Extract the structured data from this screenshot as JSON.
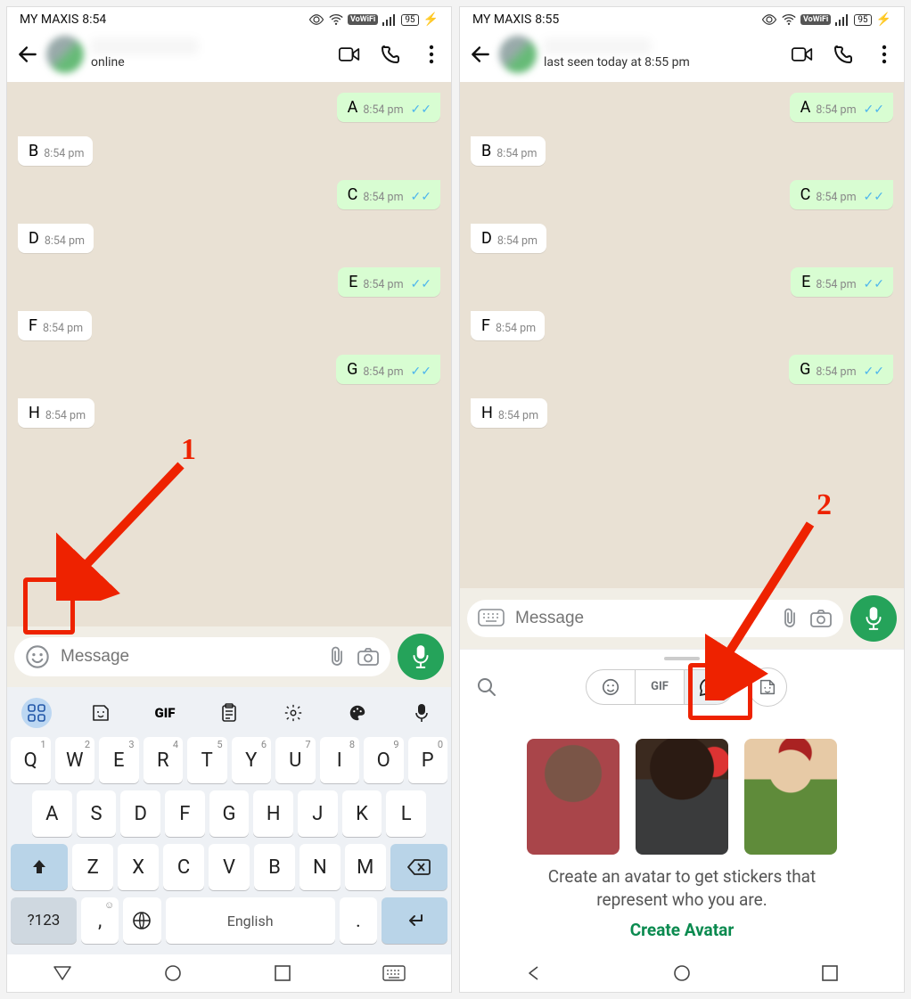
{
  "annotations": {
    "one": "1",
    "two": "2"
  },
  "left": {
    "status": {
      "carrier": "MY MAXIS",
      "time": "8:54",
      "battery": "95"
    },
    "header": {
      "sub": "online"
    },
    "messages": [
      {
        "dir": "out",
        "txt": "A",
        "time": "8:54 pm"
      },
      {
        "dir": "in",
        "txt": "B",
        "time": "8:54 pm"
      },
      {
        "dir": "out",
        "txt": "C",
        "time": "8:54 pm"
      },
      {
        "dir": "in",
        "txt": "D",
        "time": "8:54 pm"
      },
      {
        "dir": "out",
        "txt": "E",
        "time": "8:54 pm"
      },
      {
        "dir": "in",
        "txt": "F",
        "time": "8:54 pm"
      },
      {
        "dir": "out",
        "txt": "G",
        "time": "8:54 pm"
      },
      {
        "dir": "in",
        "txt": "H",
        "time": "8:54 pm"
      }
    ],
    "input": {
      "placeholder": "Message"
    },
    "kb": {
      "tool": [
        "apps",
        "sticker",
        "gif",
        "clipboard",
        "settings",
        "palette",
        "mic"
      ],
      "gif": "GIF",
      "r1": [
        "Q",
        "W",
        "E",
        "R",
        "T",
        "Y",
        "U",
        "I",
        "O",
        "P"
      ],
      "r1s": [
        "1",
        "2",
        "3",
        "4",
        "5",
        "6",
        "7",
        "8",
        "9",
        "0"
      ],
      "r2": [
        "A",
        "S",
        "D",
        "F",
        "G",
        "H",
        "J",
        "K",
        "L"
      ],
      "r3": [
        "Z",
        "X",
        "C",
        "V",
        "B",
        "N",
        "M"
      ],
      "sym": "?123",
      "lang": "English",
      "comma": ",",
      "dot": "."
    }
  },
  "right": {
    "status": {
      "carrier": "MY MAXIS",
      "time": "8:55",
      "battery": "95"
    },
    "header": {
      "sub": "last seen today at 8:55 pm"
    },
    "messages": [
      {
        "dir": "out",
        "txt": "A",
        "time": "8:54 pm"
      },
      {
        "dir": "in",
        "txt": "B",
        "time": "8:54 pm"
      },
      {
        "dir": "out",
        "txt": "C",
        "time": "8:54 pm"
      },
      {
        "dir": "in",
        "txt": "D",
        "time": "8:54 pm"
      },
      {
        "dir": "out",
        "txt": "E",
        "time": "8:54 pm"
      },
      {
        "dir": "in",
        "txt": "F",
        "time": "8:54 pm"
      },
      {
        "dir": "out",
        "txt": "G",
        "time": "8:54 pm"
      },
      {
        "dir": "in",
        "txt": "H",
        "time": "8:54 pm"
      }
    ],
    "input": {
      "placeholder": "Message"
    },
    "avatar": {
      "seg": [
        "emoji",
        "gif",
        "avatar"
      ],
      "gif": "GIF",
      "text": "Create an avatar to get stickers that represent who you are.",
      "cta": "Create Avatar"
    }
  }
}
